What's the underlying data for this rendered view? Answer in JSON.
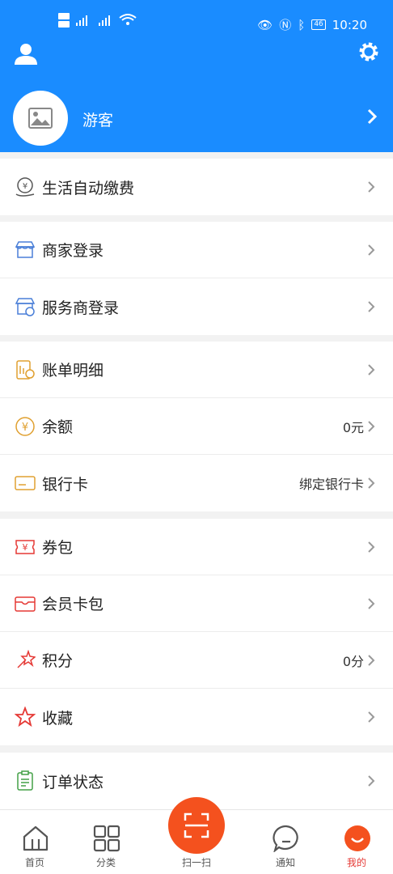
{
  "status_bar": {
    "left_text": "HD 4G  4G",
    "time": "10:20",
    "battery": "46"
  },
  "header": {
    "guest_name": "游客"
  },
  "sections": {
    "life": {
      "auto_pay": "生活自动缴费"
    },
    "merchant": {
      "merchant_login": "商家登录",
      "provider_login": "服务商登录"
    },
    "finance": {
      "bill_detail": "账单明细",
      "balance": "余额",
      "balance_value": "0元",
      "bank_card": "银行卡",
      "bank_card_value": "绑定银行卡"
    },
    "benefits": {
      "coupon": "券包",
      "member_card": "会员卡包",
      "points": "积分",
      "points_value": "0分",
      "favorites": "收藏"
    },
    "orders": {
      "order_status": "订单状态"
    }
  },
  "tabbar": {
    "home": "首页",
    "category": "分类",
    "scan": "扫一扫",
    "notice": "通知",
    "mine": "我的"
  },
  "colors": {
    "primary_blue": "#1a8cff",
    "scan_orange": "#f4511e",
    "active_red": "#e53935"
  }
}
